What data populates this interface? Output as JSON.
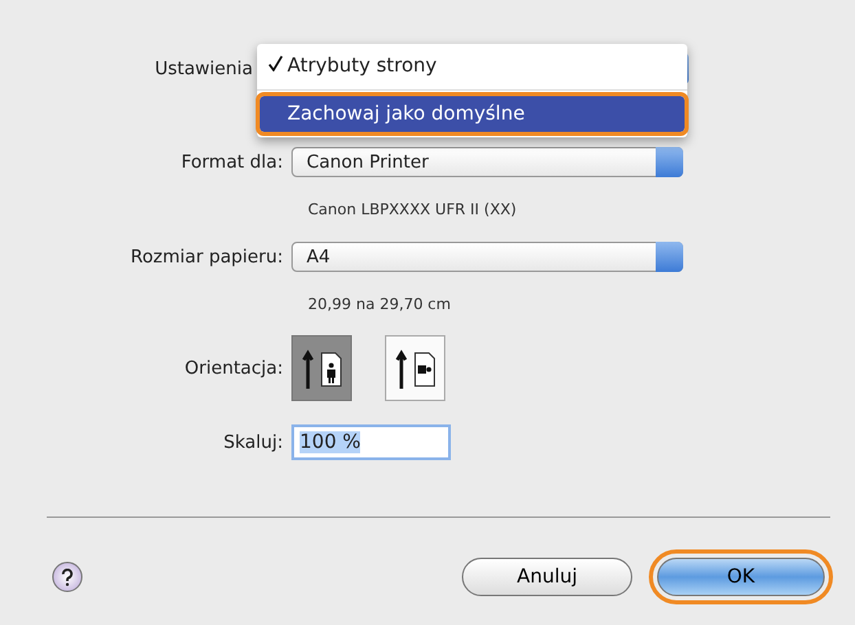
{
  "settings": {
    "label": "Ustawienia",
    "menu": [
      {
        "text": "Atrybuty strony",
        "checked": true,
        "highlighted": false,
        "outlined": false
      },
      {
        "text": "Zachowaj jako domyślne",
        "checked": false,
        "highlighted": true,
        "outlined": true
      }
    ]
  },
  "format_for": {
    "label": "Format dla:",
    "value": "Canon Printer",
    "note": "Canon LBPXXXX UFR II (XX)"
  },
  "paper_size": {
    "label": "Rozmiar papieru:",
    "value": "A4",
    "note": "20,99 na 29,70 cm"
  },
  "orientation": {
    "label": "Orientacja:",
    "options": [
      {
        "kind": "portrait",
        "selected": true
      },
      {
        "kind": "landscape",
        "selected": false
      }
    ]
  },
  "scale": {
    "label": "Skaluj:",
    "value": "100 %"
  },
  "buttons": [
    {
      "kind": "cancel",
      "label": "Anuluj",
      "outlined": false
    },
    {
      "kind": "ok",
      "label": "OK",
      "outlined": true
    }
  ]
}
